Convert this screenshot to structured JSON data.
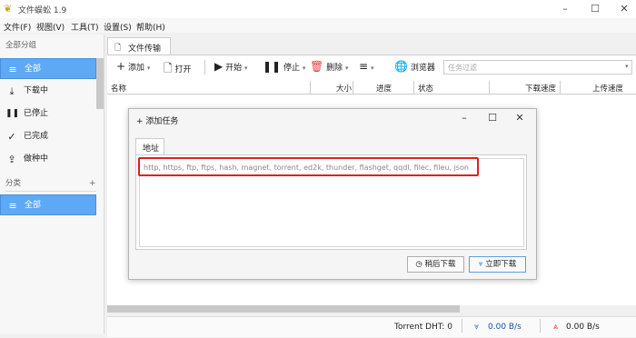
{
  "window": {
    "title": "文件蜈蚣 1.9",
    "minimize": "–",
    "maximize": "☐",
    "close": "✕"
  },
  "menu": [
    "文件(F)",
    "视图(V)",
    "工具(T)",
    "设置(S)",
    "帮助(H)"
  ],
  "sidebar": {
    "group_header": "全部分组",
    "items": [
      {
        "label": "全部",
        "icon": "≡"
      },
      {
        "label": "下载中",
        "icon": "⤓"
      },
      {
        "label": "已停止",
        "icon": "❚❚"
      },
      {
        "label": "已完成",
        "icon": "✓"
      },
      {
        "label": "做种中",
        "icon": "⇪"
      }
    ],
    "category_header": "分类",
    "add_category": "+",
    "category_items": [
      {
        "label": "全部",
        "icon": "≡"
      }
    ]
  },
  "main_tab": {
    "label": "文件传输",
    "icon": "🗋"
  },
  "toolbar": {
    "add": "添加",
    "open": "打开",
    "start": "开始",
    "stop": "停止",
    "delete": "删除",
    "browser": "浏览器",
    "filter_placeholder": "任务过滤",
    "dropdown": "▾"
  },
  "table": {
    "columns": [
      "名称",
      "大小",
      "进度",
      "状态",
      "下载速度",
      "上传速度"
    ]
  },
  "status": {
    "dht": "Torrent DHT:  0",
    "down_speed": "0.00 B/s",
    "up_speed": "0.00 B/s"
  },
  "dialog": {
    "title": "添加任务",
    "tab": "地址",
    "placeholder": "http, https, ftp, ftps, hash, magnet, torrent, ed2k, thunder, flashget, qqdl, filec, fileu, json",
    "later_button": "稍后下载",
    "now_button": "立即下载",
    "minimize": "–",
    "maximize": "☐",
    "close": "✕"
  },
  "colors": {
    "accent": "#5da9f5",
    "highlight": "#e02020"
  }
}
